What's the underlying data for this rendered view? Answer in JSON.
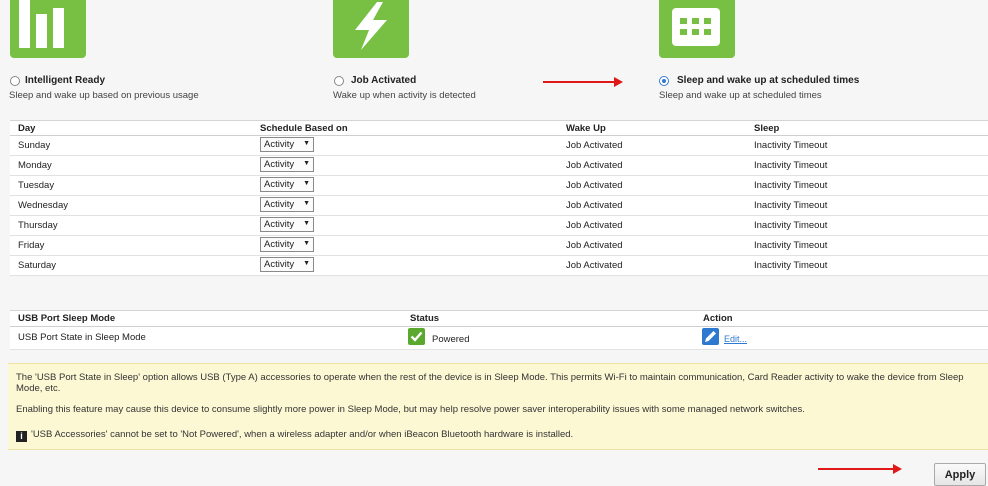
{
  "modes": [
    {
      "title": "Intelligent Ready",
      "desc": "Sleep and wake up based on previous usage",
      "icon": "bar-chart-icon",
      "selected": false
    },
    {
      "title": "Job Activated",
      "desc": "Wake up when activity is detected",
      "icon": "lightning-icon",
      "selected": false
    },
    {
      "title": "Sleep and wake up at scheduled times",
      "desc": "Sleep and wake up at scheduled times",
      "icon": "calendar-icon",
      "selected": true
    }
  ],
  "schedule": {
    "headers": {
      "day": "Day",
      "based_on": "Schedule Based on",
      "wake": "Wake Up",
      "sleep": "Sleep"
    },
    "rows": [
      {
        "day": "Sunday",
        "based_on": "Activity",
        "wake": "Job Activated",
        "sleep": "Inactivity Timeout"
      },
      {
        "day": "Monday",
        "based_on": "Activity",
        "wake": "Job Activated",
        "sleep": "Inactivity Timeout"
      },
      {
        "day": "Tuesday",
        "based_on": "Activity",
        "wake": "Job Activated",
        "sleep": "Inactivity Timeout"
      },
      {
        "day": "Wednesday",
        "based_on": "Activity",
        "wake": "Job Activated",
        "sleep": "Inactivity Timeout"
      },
      {
        "day": "Thursday",
        "based_on": "Activity",
        "wake": "Job Activated",
        "sleep": "Inactivity Timeout"
      },
      {
        "day": "Friday",
        "based_on": "Activity",
        "wake": "Job Activated",
        "sleep": "Inactivity Timeout"
      },
      {
        "day": "Saturday",
        "based_on": "Activity",
        "wake": "Job Activated",
        "sleep": "Inactivity Timeout"
      }
    ]
  },
  "usb": {
    "headers": {
      "mode": "USB Port Sleep Mode",
      "status": "Status",
      "action": "Action"
    },
    "row": {
      "mode": "USB Port State in Sleep Mode",
      "status": "Powered",
      "action": "Edit..."
    }
  },
  "info": {
    "p1": "The 'USB Port State in Sleep' option allows USB (Type A) accessories to operate when the rest of the device is in Sleep Mode. This permits Wi-Fi to maintain communication, Card Reader activity to wake the device from Sleep Mode, etc.",
    "p2": "Enabling this feature may cause this device to consume slightly more power in Sleep Mode, but may help resolve power saver interoperability issues with some managed network switches.",
    "p3": "'USB Accessories' cannot be set to 'Not Powered', when a wireless adapter and/or when iBeacon Bluetooth hardware is installed."
  },
  "apply_label": "Apply",
  "colors": {
    "tile": "#77c043",
    "arrow": "#e01818",
    "info_bg": "#fdf8d4",
    "link": "#2d79cf"
  }
}
